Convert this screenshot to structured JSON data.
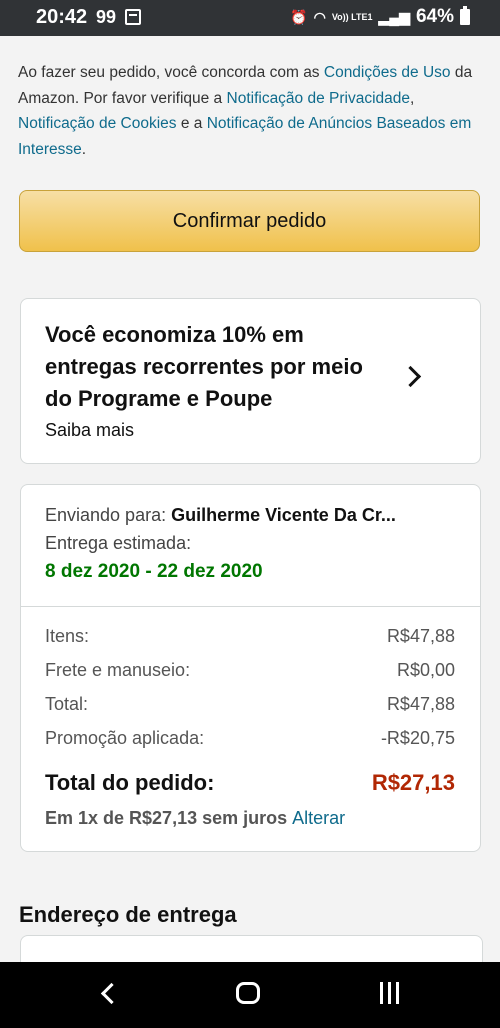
{
  "status_bar": {
    "time": "20:42",
    "notification": "99",
    "battery": "64%",
    "network_label": "Vo)) LTE1"
  },
  "consent": {
    "prefix": "Ao fazer seu pedido, você concorda com as ",
    "link_terms": "Condições de Uso",
    "mid1": " da Amazon. Por favor verifique a ",
    "link_privacy": "Notificação de Privacidade",
    "comma": ", ",
    "link_cookies": "Notificação de Cookies",
    "mid2": " e a ",
    "link_ads": "Notificação de Anúncios Baseados em Interesse",
    "end": "."
  },
  "confirm_button": {
    "label": "Confirmar pedido"
  },
  "promo": {
    "title": "Você economiza 10% em entregas recorrentes por meio do Programe e Poupe",
    "link": "Saiba mais"
  },
  "summary": {
    "ship_label": "Enviando para: ",
    "ship_name": "Guilherme Vicente Da Cr...",
    "eta_label": "Entrega estimada:",
    "eta_date": "8 dez 2020 - 22 dez 2020",
    "rows": [
      {
        "label": "Itens:",
        "value": "R$47,88"
      },
      {
        "label": "Frete e manuseio:",
        "value": "R$0,00"
      },
      {
        "label": "Total:",
        "value": "R$47,88"
      },
      {
        "label": "Promoção aplicada:",
        "value": "-R$20,75"
      }
    ],
    "total_label": "Total do pedido:",
    "total_value": "R$27,13",
    "installment": "Em 1x de R$27,13 sem juros",
    "change_link": "Alterar"
  },
  "address": {
    "title": "Endereço de entrega"
  },
  "colors": {
    "accent_link": "#0f6b8c",
    "button": "#f0c14b",
    "green": "#007600",
    "price": "#b12704"
  }
}
